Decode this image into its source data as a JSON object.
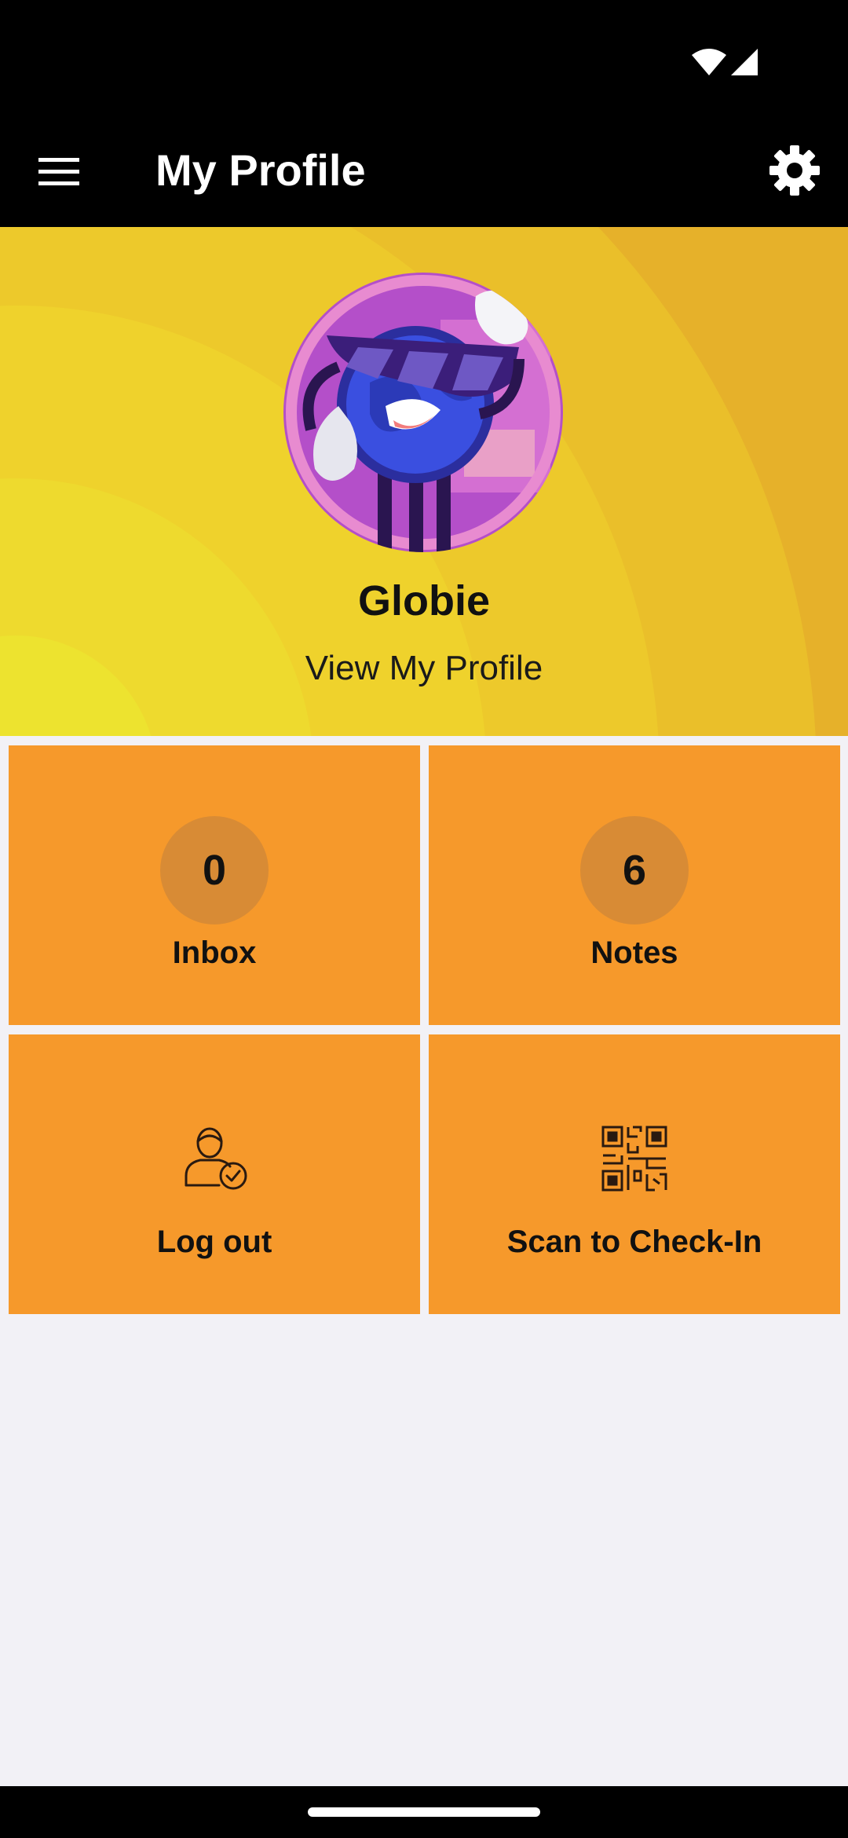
{
  "status_bar": {
    "icons": [
      "wifi-icon",
      "cellular-signal-icon"
    ]
  },
  "app_bar": {
    "title": "My Profile",
    "menu_icon": "hamburger-menu-icon",
    "settings_icon": "gear-icon"
  },
  "profile": {
    "name": "Globie",
    "view_profile_label": "View My Profile",
    "avatar_description": "globie-avatar"
  },
  "tiles": [
    {
      "label": "Inbox",
      "count": "0"
    },
    {
      "label": "Notes",
      "count": "6"
    },
    {
      "label": "Log out",
      "icon": "user-check-icon"
    },
    {
      "label": "Scan to Check-In",
      "icon": "qr-code-icon"
    }
  ],
  "colors": {
    "app_bar": "#000000",
    "banner_yellow": "#F0D52E",
    "tile_orange": "#F6992B",
    "badge_orange": "#D88B35",
    "page_background": "#F2F1F6"
  }
}
